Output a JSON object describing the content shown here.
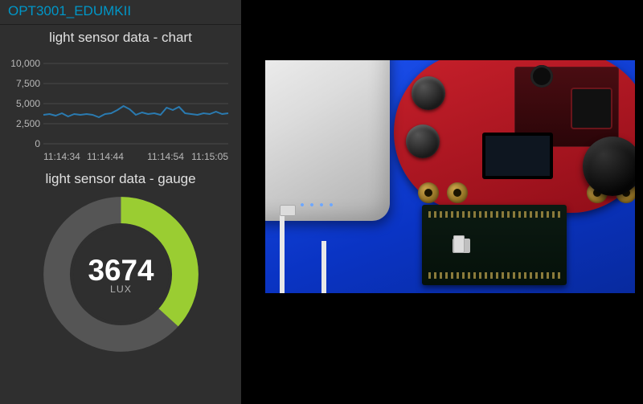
{
  "app": {
    "title": "OPT3001_EDUMKII"
  },
  "chart": {
    "title": "light sensor data - chart"
  },
  "gauge": {
    "title": "light sensor data - gauge",
    "value": "3674",
    "unit": "LUX",
    "max": 10000
  },
  "chart_data": {
    "type": "line",
    "title": "light sensor data - chart",
    "xlabel": "",
    "ylabel": "",
    "ylim": [
      0,
      10000
    ],
    "y_ticks": [
      0,
      2500,
      5000,
      7500,
      10000
    ],
    "x_tick_labels": [
      "11:14:34",
      "11:14:44",
      "11:14:54",
      "11:15:05"
    ],
    "x": [
      0,
      1,
      2,
      3,
      4,
      5,
      6,
      7,
      8,
      9,
      10,
      11,
      12,
      13,
      14,
      15,
      16,
      17,
      18,
      19,
      20,
      21,
      22,
      23,
      24,
      25,
      26,
      27,
      28,
      29,
      30
    ],
    "values": [
      3600,
      3700,
      3500,
      3800,
      3400,
      3700,
      3600,
      3700,
      3600,
      3300,
      3700,
      3800,
      4200,
      4700,
      4300,
      3600,
      3900,
      3700,
      3800,
      3600,
      4500,
      4200,
      4600,
      3800,
      3700,
      3600,
      3800,
      3700,
      4000,
      3700,
      3800
    ],
    "series": [
      {
        "name": "LUX",
        "color": "#2a7ab0",
        "values": [
          3600,
          3700,
          3500,
          3800,
          3400,
          3700,
          3600,
          3700,
          3600,
          3300,
          3700,
          3800,
          4200,
          4700,
          4300,
          3600,
          3900,
          3700,
          3800,
          3600,
          4500,
          4200,
          4600,
          3800,
          3700,
          3600,
          3800,
          3700,
          4000,
          3700,
          3800
        ]
      }
    ]
  }
}
